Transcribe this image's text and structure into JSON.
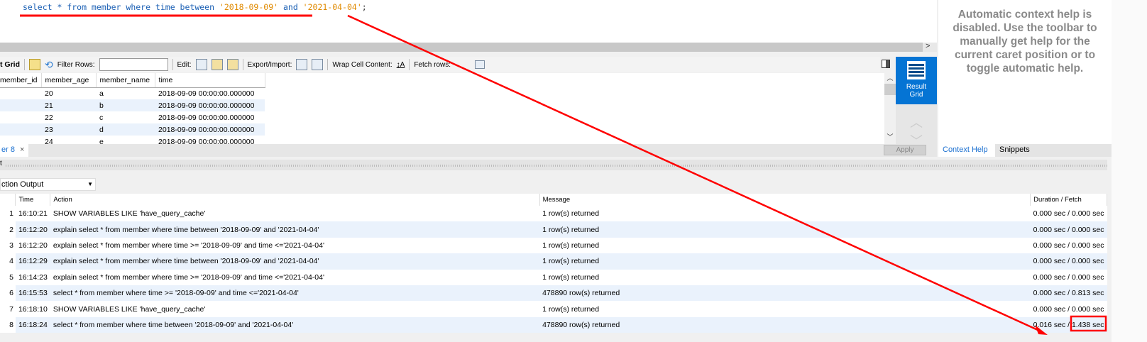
{
  "editor": {
    "sql_keyword": "select * from member where time between ",
    "date1": "'2018-09-09'",
    "and": " and ",
    "date2": "'2021-04-04'",
    "semi": ";"
  },
  "help": {
    "text": "Automatic context help is disabled. Use the toolbar to manually get help for the current caret position or to toggle automatic help.",
    "tabs": [
      "Context Help",
      "Snippets"
    ]
  },
  "toolbar": {
    "grid_label": "t Grid",
    "filter_label": "Filter Rows:",
    "filter_value": "",
    "edit_label": "Edit:",
    "export_label": "Export/Import:",
    "wrap_label": "Wrap Cell Content:",
    "fetch_label": "Fetch rows:"
  },
  "grid": {
    "columns": [
      "member_id",
      "member_age",
      "member_name",
      "time"
    ],
    "rows": [
      [
        "",
        "20",
        "a",
        "2018-09-09 00:00:00.000000"
      ],
      [
        "",
        "21",
        "b",
        "2018-09-09 00:00:00.000000"
      ],
      [
        "",
        "22",
        "c",
        "2018-09-09 00:00:00.000000"
      ],
      [
        "",
        "23",
        "d",
        "2018-09-09 00:00:00.000000"
      ],
      [
        "",
        "24",
        "e",
        "2018-09-09 00:00:00.000000"
      ]
    ]
  },
  "side": {
    "result_grid": "Result Grid"
  },
  "tabs": {
    "query_tab": "er 8",
    "apply": "Apply"
  },
  "output": {
    "splitter_label": "t",
    "dropdown": "ction Output",
    "columns": [
      "",
      "Time",
      "Action",
      "Message",
      "Duration / Fetch"
    ],
    "rows": [
      [
        "1",
        "16:10:21",
        "SHOW VARIABLES LIKE 'have_query_cache'",
        "1 row(s) returned",
        "0.000 sec / 0.000 sec"
      ],
      [
        "2",
        "16:12:20",
        "explain select * from member where time between '2018-09-09' and '2021-04-04'",
        "1 row(s) returned",
        "0.000 sec / 0.000 sec"
      ],
      [
        "3",
        "16:12:20",
        "explain select * from member where time >= '2018-09-09' and time <='2021-04-04'",
        "1 row(s) returned",
        "0.000 sec / 0.000 sec"
      ],
      [
        "4",
        "16:12:29",
        "explain select * from member where time between '2018-09-09' and '2021-04-04'",
        "1 row(s) returned",
        "0.000 sec / 0.000 sec"
      ],
      [
        "5",
        "16:14:23",
        "explain select * from member where time >= '2018-09-09' and time <='2021-04-04'",
        "1 row(s) returned",
        "0.000 sec / 0.000 sec"
      ],
      [
        "6",
        "16:15:53",
        "select * from member where time >= '2018-09-09' and time <='2021-04-04'",
        "478890 row(s) returned",
        "0.000 sec / 0.813 sec"
      ],
      [
        "7",
        "16:18:10",
        "SHOW VARIABLES LIKE 'have_query_cache'",
        "1 row(s) returned",
        "0.000 sec / 0.000 sec"
      ],
      [
        "8",
        "16:18:24",
        "select * from member where time between '2018-09-09' and '2021-04-04'",
        "478890 row(s) returned",
        "0.016 sec / 1.438 sec"
      ]
    ]
  },
  "colors": {
    "annotation": "#ff0000",
    "accent": "#0574d4"
  }
}
